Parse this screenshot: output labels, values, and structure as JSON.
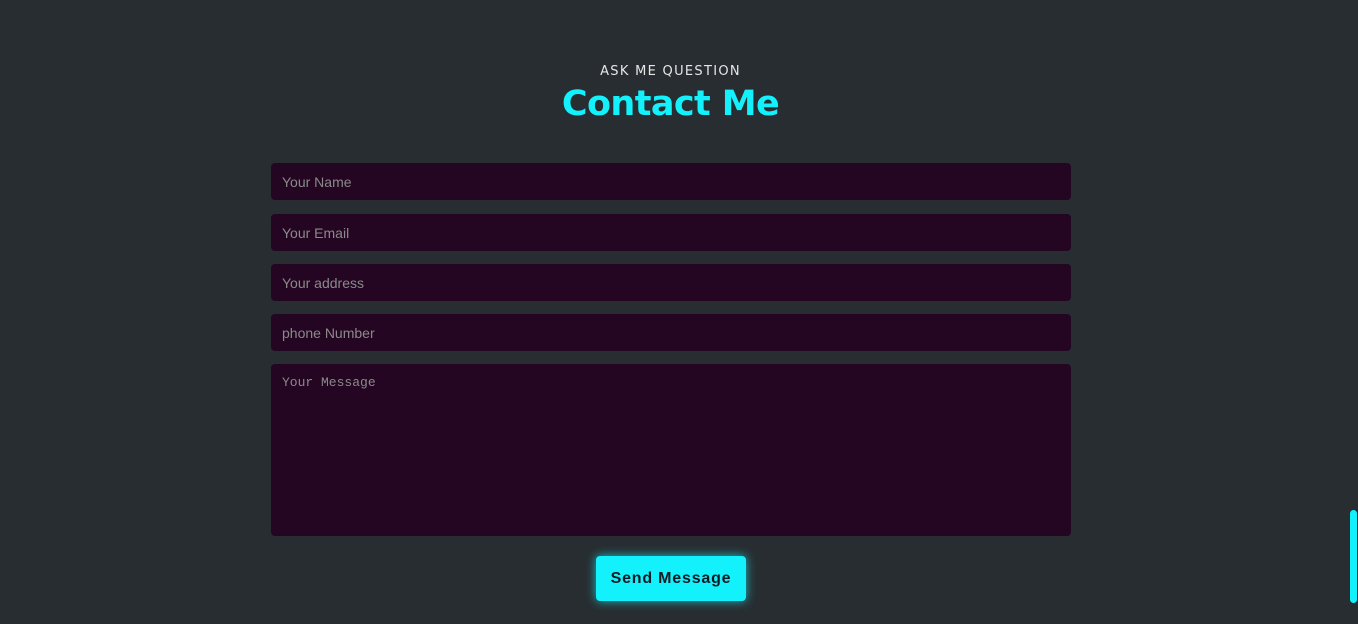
{
  "section": {
    "eyebrow": "ASK ME QUESTION",
    "title": "Contact Me"
  },
  "form": {
    "name_placeholder": "Your Name",
    "email_placeholder": "Your Email",
    "address_placeholder": "Your address",
    "phone_placeholder": "phone Number",
    "message_placeholder": "Your Message",
    "submit_label": "Send Message"
  },
  "colors": {
    "background": "#282d31",
    "accent": "#13f1fc",
    "field_background": "#240622"
  }
}
